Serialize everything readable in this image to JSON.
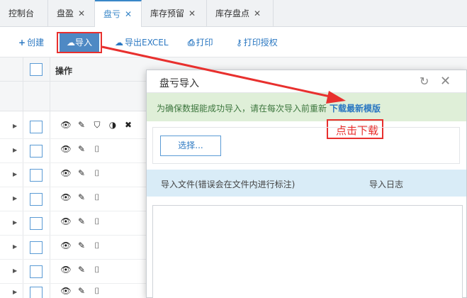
{
  "tabs": [
    {
      "label": "控制台",
      "closable": false,
      "active": false
    },
    {
      "label": "盘盈",
      "closable": true,
      "active": false
    },
    {
      "label": "盘亏",
      "closable": true,
      "active": true
    },
    {
      "label": "库存预留",
      "closable": true,
      "active": false
    },
    {
      "label": "库存盘点",
      "closable": true,
      "active": false
    }
  ],
  "tab_close_glyph": "✕",
  "toolbar": {
    "create_label": "创建",
    "import_label": "导入",
    "export_label": "导出EXCEL",
    "print_label": "打印",
    "print_auth_label": "打印授权"
  },
  "table": {
    "header_actions": "操作",
    "row_count": 8
  },
  "modal": {
    "title": "盘亏导入",
    "notice_text": "为确保数据能成功导入，请在每次导入前重新",
    "download_link": "下载最新模版",
    "choose_button": "选择...",
    "col_file": "导入文件(错误会在文件内进行标注)",
    "col_log": "导入日志"
  },
  "annotation": {
    "label": "点击下载",
    "color": "#e8302e"
  },
  "colors": {
    "accent": "#2b78c2",
    "primary_button": "#4e89c4",
    "success_bg": "#dfefd8",
    "info_bg": "#d9ecf7"
  }
}
